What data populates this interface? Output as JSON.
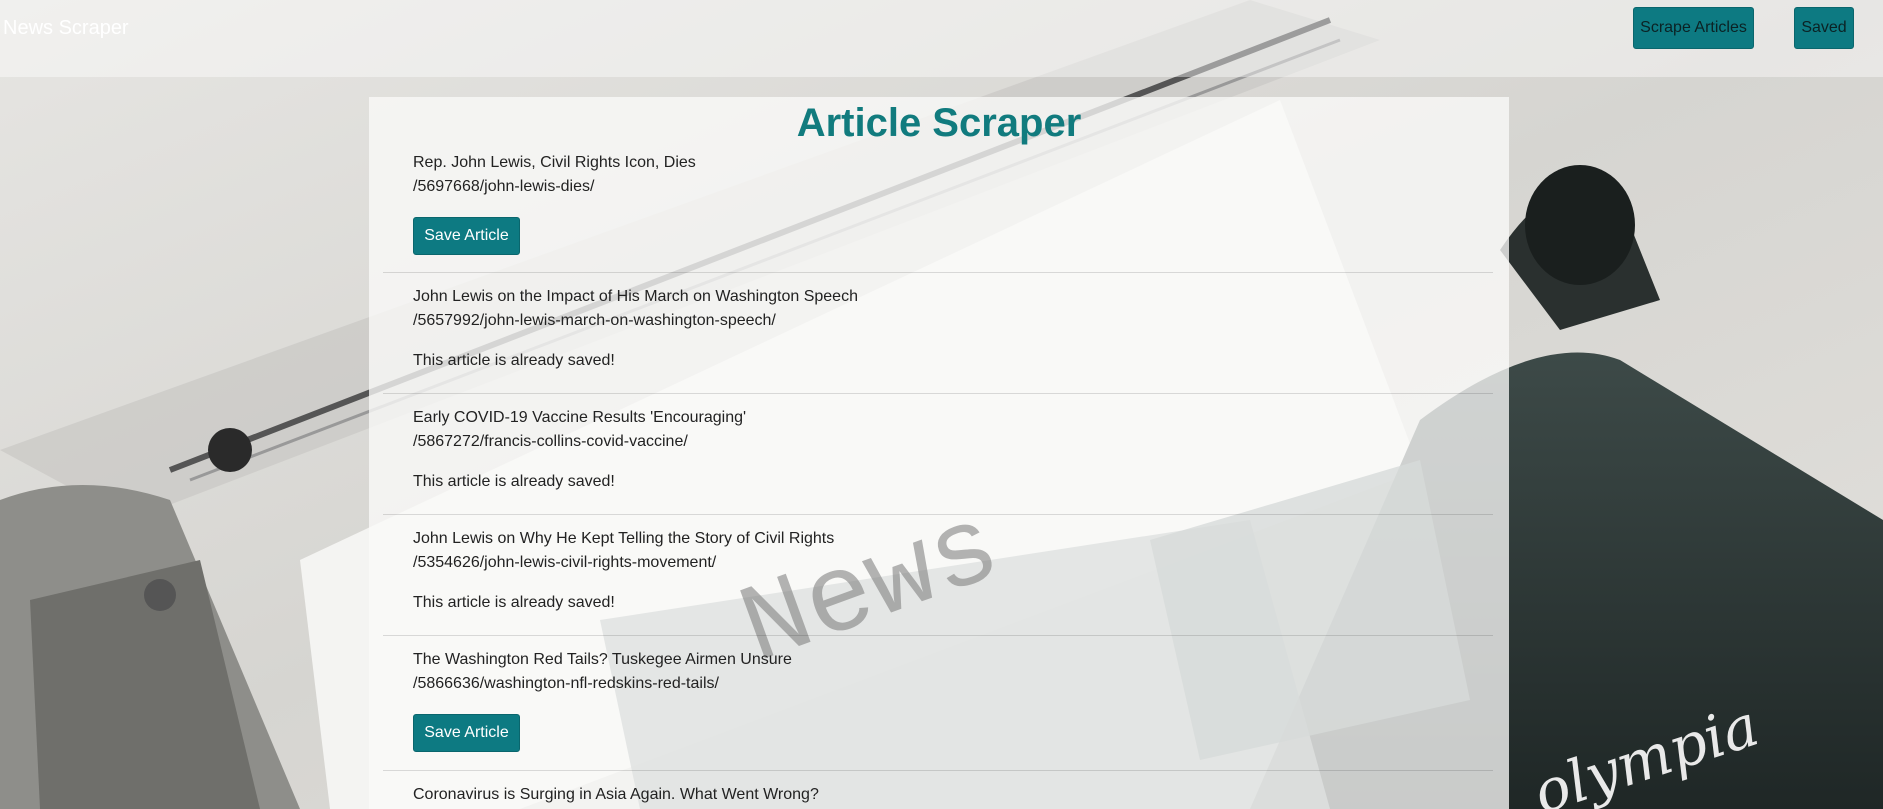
{
  "navbar": {
    "brand": "News Scraper",
    "scrape_label": "Scrape Articles",
    "saved_label": "Saved"
  },
  "background": {
    "paper_text": "News",
    "logo_text": "olympia"
  },
  "main": {
    "title": "Article Scraper",
    "save_label": "Save Article",
    "already_saved_label": "This article is already saved!",
    "articles": [
      {
        "title": "Rep. John Lewis, Civil Rights Icon, Dies",
        "link": "/5697668/john-lewis-dies/",
        "saved": false
      },
      {
        "title": "John Lewis on the Impact of His March on Washington Speech",
        "link": "/5657992/john-lewis-march-on-washington-speech/",
        "saved": true
      },
      {
        "title": "Early COVID-19 Vaccine Results 'Encouraging'",
        "link": "/5867272/francis-collins-covid-vaccine/",
        "saved": true
      },
      {
        "title": "John Lewis on Why He Kept Telling the Story of Civil Rights",
        "link": "/5354626/john-lewis-civil-rights-movement/",
        "saved": true
      },
      {
        "title": "The Washington Red Tails? Tuskegee Airmen Unsure",
        "link": "/5866636/washington-nfl-redskins-red-tails/",
        "saved": false
      },
      {
        "title": "Coronavirus is Surging in Asia Again. What Went Wrong?",
        "link": "",
        "saved": false
      }
    ]
  },
  "colors": {
    "accent": "#0d7a82",
    "title": "#117b7e"
  }
}
